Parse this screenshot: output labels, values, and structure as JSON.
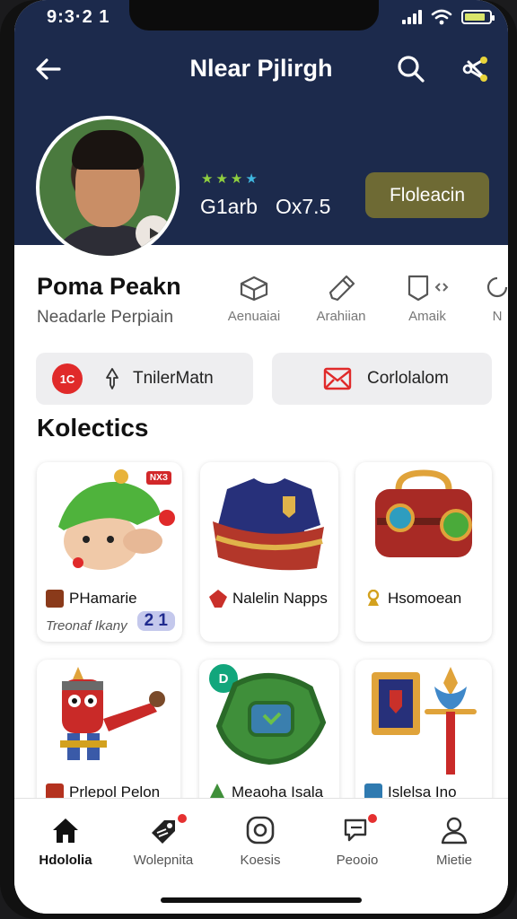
{
  "status_bar": {
    "time": "9:3·2 1"
  },
  "header": {
    "title": "Nlear Pjlirgh"
  },
  "profile": {
    "stat_a": "G1arb",
    "stat_b": "Ox7.5",
    "follow_label": "Floleacin",
    "star_count": 4,
    "star_color": "#8fcf3f"
  },
  "user": {
    "name": "Poma Peakn",
    "subtitle": "Neadarle Perpiain"
  },
  "actions": [
    {
      "label": "Aenuaiai",
      "icon": "box-icon"
    },
    {
      "label": "Arahiian",
      "icon": "pencil-icon"
    },
    {
      "label": "Amaik",
      "icon": "bookmark-icon"
    },
    {
      "label": "N",
      "icon": "refresh-icon"
    }
  ],
  "pills": [
    {
      "label": "TnilerMatn",
      "icon": "pin-icon"
    },
    {
      "label": "Corlolalom",
      "icon": "mail-icon"
    }
  ],
  "collections": {
    "title": "Kolectics",
    "items": [
      {
        "title": "PHamarie",
        "subtitle": "Treonaf Ikany",
        "badge": "2 1",
        "tag": "NXЗ",
        "icon": "chest-icon"
      },
      {
        "title": "Nalelin Napps",
        "icon": "gem-icon"
      },
      {
        "title": "Hsomoean",
        "icon": "bell-icon"
      },
      {
        "title": "Prlepol Pelon",
        "icon": "chest-icon"
      },
      {
        "title": "Meaoha Isala",
        "icon": "tree-icon",
        "icon_tag": "D"
      },
      {
        "title": "Islelsa Ino",
        "icon": "scroll-icon"
      }
    ]
  },
  "bottom_nav": [
    {
      "label": "Hdololia",
      "icon": "home-icon",
      "active": true
    },
    {
      "label": "Wolepnita",
      "icon": "tag-icon",
      "dot": true
    },
    {
      "label": "Koesis",
      "icon": "target-icon"
    },
    {
      "label": "Peooio",
      "icon": "chat-icon",
      "dot": true
    },
    {
      "label": "Mietie",
      "icon": "user-icon"
    }
  ],
  "colors": {
    "header_bg": "#1c2a4c",
    "follow_btn": "#6e6a34",
    "badge": "#c4c8ec"
  }
}
